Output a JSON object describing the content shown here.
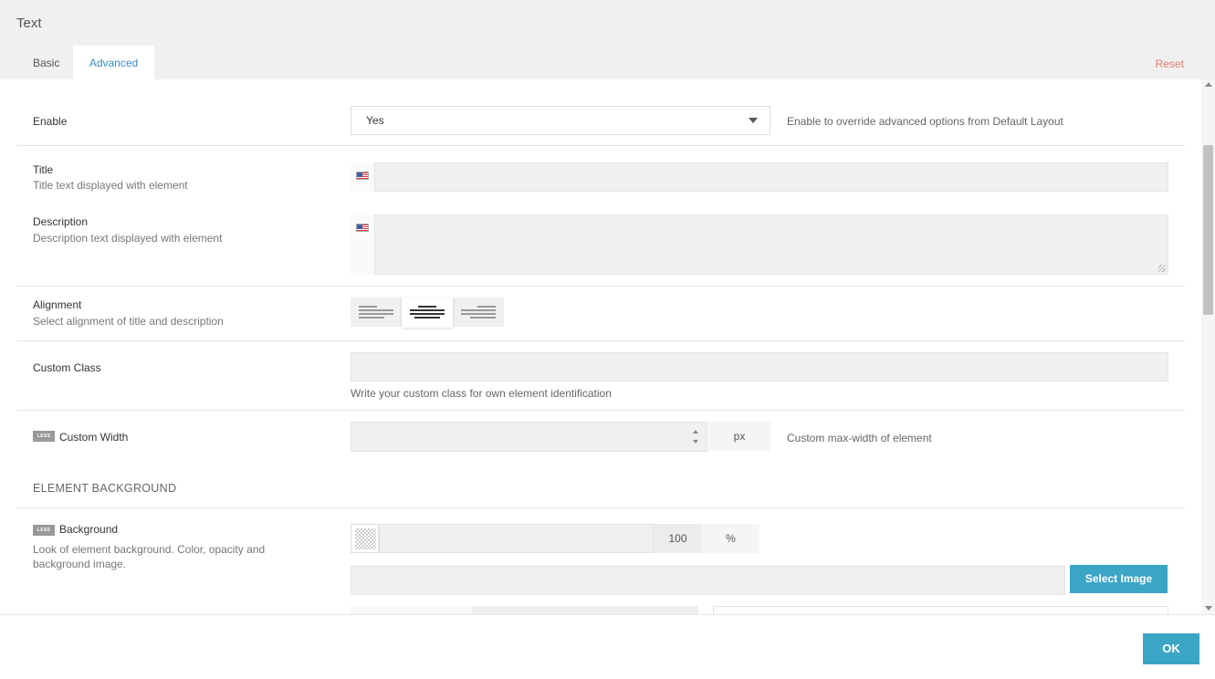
{
  "dialog": {
    "title": "Text"
  },
  "tabs": [
    {
      "label": "Basic"
    },
    {
      "label": "Advanced"
    }
  ],
  "reset_label": "Reset",
  "enable": {
    "label": "Enable",
    "value": "Yes",
    "help": "Enable to override advanced options from Default Layout"
  },
  "title_field": {
    "label": "Title",
    "sub": "Title text displayed with element",
    "value": ""
  },
  "description_field": {
    "label": "Description",
    "sub": "Description text displayed with element",
    "value": ""
  },
  "alignment": {
    "label": "Alignment",
    "sub": "Select alignment of title and description",
    "selected": "center",
    "options": [
      "left",
      "center",
      "right"
    ]
  },
  "custom_class": {
    "label": "Custom Class",
    "value": "",
    "help": "Write your custom class for own element identification"
  },
  "custom_width": {
    "badge": "LESS",
    "label": "Custom Width",
    "value": "",
    "unit": "px",
    "help": "Custom max-width of element"
  },
  "element_background": {
    "section_title": "ELEMENT BACKGROUND"
  },
  "background": {
    "badge": "LESS",
    "label": "Background",
    "sub": "Look of element background. Color, opacity and background image.",
    "color": "",
    "opacity": "100",
    "opacity_unit": "%",
    "image": "",
    "select_image_label": "Select Image"
  },
  "footer": {
    "ok_label": "OK"
  },
  "colors": {
    "accent": "#3ba5c6",
    "tab_active": "#3a8fc5",
    "reset": "#e07a6a"
  }
}
